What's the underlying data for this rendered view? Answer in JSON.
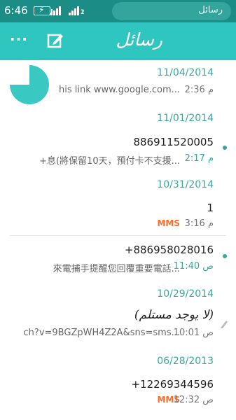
{
  "status_bar": {
    "time": "6:46",
    "sim1": "1",
    "sim2": "2",
    "search_label": "رسائل"
  },
  "header": {
    "title": "رسائل",
    "menu_icon": "more-horizontal-icon",
    "compose_icon": "compose-icon"
  },
  "threads": [
    {
      "date": "11/04/2014",
      "preview": "his link www.google.com...",
      "time": "2:36 م",
      "unread": false,
      "avatar": true
    },
    {
      "date": "11/01/2014",
      "name": "886911520005",
      "preview": "+息(將保留10天，預付卡不支援...",
      "time": "2:17 م",
      "unread": true
    },
    {
      "date": "10/31/2014",
      "name": "1",
      "time": "3:16 م",
      "badge": "MMS",
      "unread": false
    },
    {
      "name": "+886958028016",
      "preview": "來電捕手提醒您回覆重要電話...",
      "time": "11:40 ص",
      "unread": true
    },
    {
      "date": "10/29/2014",
      "name": "(لا يوجد مستلم)",
      "preview": "ch?v=9BGZpWH4Z2A&sns=sms...",
      "time": "10:01 ص",
      "draft": true
    },
    {
      "date": "06/28/2013",
      "name": "+12269344596",
      "time": "12:32 ص",
      "badge": "MMS"
    }
  ],
  "colors": {
    "statusbar": "#1c8d86",
    "header": "#2fc6bf",
    "accent": "#3aa6a2",
    "mms": "#ff6a2b"
  }
}
